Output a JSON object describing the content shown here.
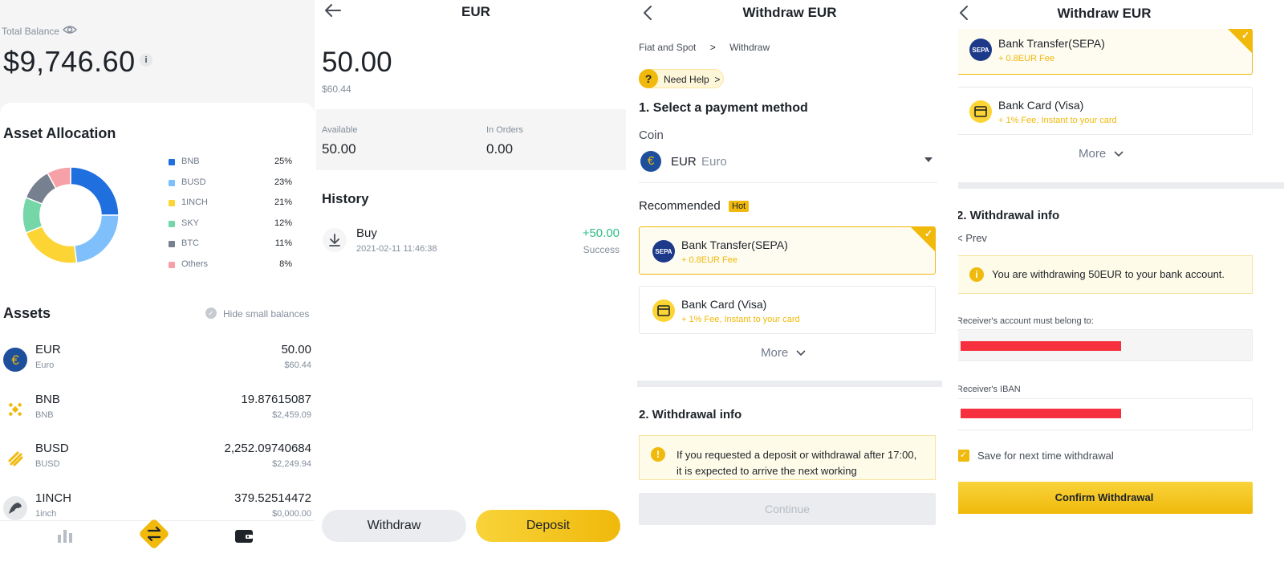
{
  "wallet": {
    "total_balance_label": "Total Balance",
    "total_balance": "$9,746.60",
    "info_glyph": "i",
    "allocation_title": "Asset Allocation",
    "allocation": [
      {
        "name": "BNB",
        "pct": "25%",
        "value": 25,
        "color": "#1f6fde"
      },
      {
        "name": "BUSD",
        "pct": "23%",
        "value": 23,
        "color": "#7fc0fc"
      },
      {
        "name": "1INCH",
        "pct": "21%",
        "value": 21,
        "color": "#fcd535"
      },
      {
        "name": "SKY",
        "pct": "12%",
        "value": 12,
        "color": "#75d6a7"
      },
      {
        "name": "BTC",
        "pct": "11%",
        "value": 11,
        "color": "#76808f"
      },
      {
        "name": "Others",
        "pct": "8%",
        "value": 8,
        "color": "#f6a0a8"
      }
    ],
    "assets_title": "Assets",
    "hide_small_label": "Hide small balances",
    "assets": [
      {
        "symbol": "EUR",
        "name": "Euro",
        "amount": "50.00",
        "usd": "$60.44",
        "icon": "euro-coin-icon"
      },
      {
        "symbol": "BNB",
        "name": "BNB",
        "amount": "19.87615087",
        "usd": "$2,459.09",
        "icon": "bnb-coin-icon"
      },
      {
        "symbol": "BUSD",
        "name": "BUSD",
        "amount": "2,252.09740684",
        "usd": "$2,249.94",
        "icon": "busd-coin-icon"
      },
      {
        "symbol": "1INCH",
        "name": "1inch",
        "amount": "379.52514472",
        "usd": "$0,000.00",
        "icon": "1inch-coin-icon"
      }
    ],
    "nav": [
      "chart-icon",
      "trade-swap-icon",
      "wallet-icon"
    ]
  },
  "eur": {
    "title": "EUR",
    "balance": "50.00",
    "balance_usd": "$60.44",
    "available_label": "Available",
    "available": "50.00",
    "in_orders_label": "In Orders",
    "in_orders": "0.00",
    "history_title": "History",
    "history": [
      {
        "type": "Buy",
        "time": "2021-02-11 11:46:38",
        "amount": "+50.00",
        "status": "Success"
      }
    ],
    "withdraw_label": "Withdraw",
    "deposit_label": "Deposit"
  },
  "withdraw1": {
    "title": "Withdraw EUR",
    "breadcrumb": [
      "Fiat and Spot",
      "Withdraw"
    ],
    "breadcrumb_sep": ">",
    "help_label": "Need Help  >",
    "help_glyph": "?",
    "step1": "1. Select a payment method",
    "coin_label": "Coin",
    "coin_symbol": "EUR",
    "coin_name": "Euro",
    "recommended_label": "Recommended",
    "hot_label": "Hot",
    "methods": [
      {
        "title": "Bank Transfer(SEPA)",
        "sub": "+ 0.8EUR Fee",
        "logo_text": "SEPA"
      },
      {
        "title": "Bank Card (Visa)",
        "sub": "+ 1% Fee, Instant to your card"
      }
    ],
    "more_label": "More",
    "step2": "2. Withdrawal info",
    "notice_glyph": "!",
    "notice": "If you requested a deposit or withdrawal after 17:00, it is expected to arrive the next working",
    "continue_label": "Continue"
  },
  "withdraw2": {
    "title": "Withdraw EUR",
    "methods": [
      {
        "title": "Bank Transfer(SEPA)",
        "sub": "+ 0.8EUR Fee",
        "logo_text": "SEPA"
      },
      {
        "title": "Bank Card (Visa)",
        "sub": "+ 1% Fee, Instant to your card"
      }
    ],
    "more_label": "More",
    "step2": "2. Withdrawal info",
    "prev_label": "< Prev",
    "notice_glyph": "i",
    "notice": "You are withdrawing 50EUR to your bank account.",
    "account_label": "Receiver's account must belong to:",
    "iban_label": "Receiver's IBAN",
    "save_label": "Save for next time withdrawal",
    "save_checked": true,
    "confirm_label": "Confirm Withdrawal"
  }
}
